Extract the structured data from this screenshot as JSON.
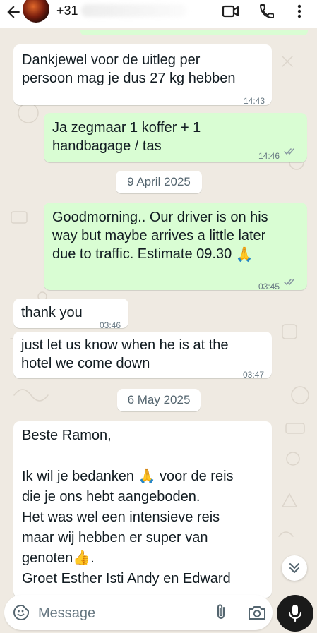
{
  "header": {
    "contact_name": "+31",
    "icons": [
      "back-arrow-icon",
      "avatar",
      "video-call-icon",
      "phone-icon",
      "more-vert-icon"
    ]
  },
  "messages": [
    {
      "direction": "in",
      "text": "Dankjewel voor de uitleg per\npersoon mag je dus 27 kg hebben",
      "time": "14:43"
    },
    {
      "direction": "out",
      "text": "Ja zegmaar 1 koffer + 1\nhandbagage / tas",
      "time": "14:46",
      "status": "read"
    },
    {
      "type": "date",
      "text": "9 April 2025"
    },
    {
      "direction": "out",
      "text_line1": "Goodmorning.. Our driver is on his",
      "text_line2": "way but maybe arrives a little later",
      "text_line3": "due to traffic. Estimate 09.30",
      "emoji": "🙏",
      "time": "03:45",
      "status": "read"
    },
    {
      "direction": "in",
      "text": "thank you",
      "time": "03:46"
    },
    {
      "direction": "in",
      "text": "just let us know when he is at the\nhotel we come down",
      "time": "03:47"
    },
    {
      "type": "date",
      "text": "6 May 2025"
    },
    {
      "direction": "in",
      "line1": "Beste Ramon,",
      "line2a": "Ik wil je bedanken",
      "line2_emoji": "🙏",
      "line2b": "voor de reis",
      "line3": "die je ons hebt aangeboden.",
      "line4": "Het was wel een intensieve reis",
      "line5": "maar wij hebben er super van",
      "line6a": "genoten",
      "line6_emoji": "👍",
      "line6b": ".",
      "line7": "Groet Esther Isti Andy en Edward"
    }
  ],
  "input": {
    "placeholder": "Message",
    "value": ""
  },
  "colors": {
    "wallpaper": "#efeae2",
    "incoming_bubble": "#ffffff",
    "outgoing_bubble": "#d9fdd3",
    "read_ticks": "#53bdeb",
    "mic_button": "#1a1a1a"
  }
}
